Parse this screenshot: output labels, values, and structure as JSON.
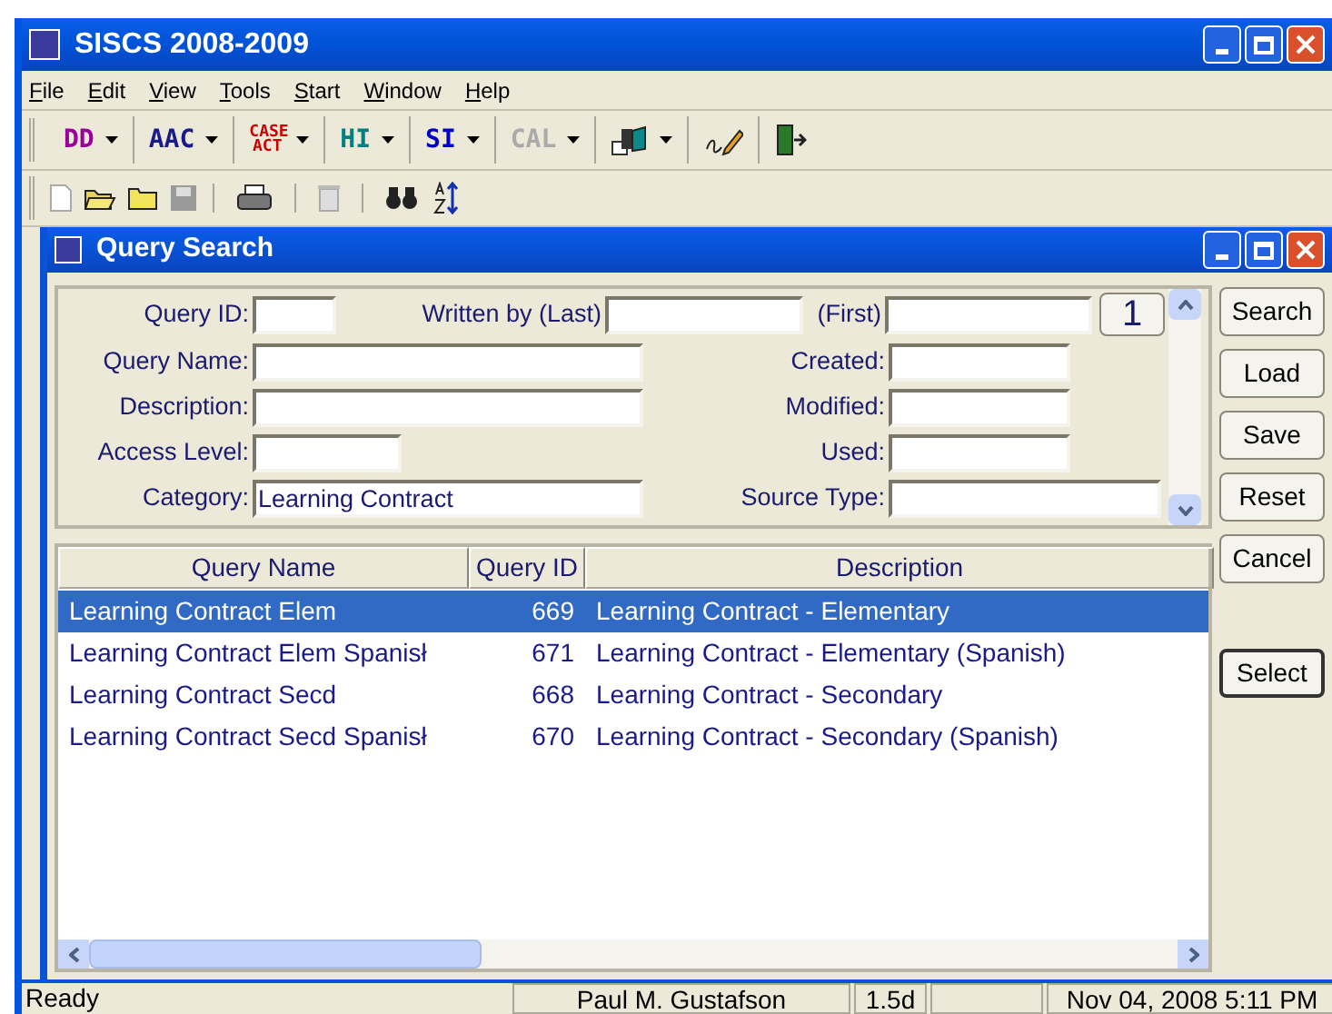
{
  "window": {
    "title": "SISCS 2008-2009"
  },
  "menu": [
    "File",
    "Edit",
    "View",
    "Tools",
    "Start",
    "Window",
    "Help"
  ],
  "toolbar": [
    {
      "kind": "text",
      "label": "DD",
      "color": "#990099",
      "disabled": false
    },
    {
      "kind": "text",
      "label": "AAC",
      "color": "#1a1a8a",
      "disabled": false
    },
    {
      "kind": "stack",
      "label": "CASE ACT",
      "color": "#cc0000",
      "disabled": false
    },
    {
      "kind": "text",
      "label": "HI",
      "color": "#008080",
      "disabled": false
    },
    {
      "kind": "text",
      "label": "SI",
      "color": "#0000cc",
      "disabled": false
    },
    {
      "kind": "text",
      "label": "CAL",
      "disabled": true
    },
    {
      "kind": "folder-menu"
    },
    {
      "kind": "pencil"
    },
    {
      "kind": "door"
    }
  ],
  "query_window": {
    "title": "Query Search",
    "form": {
      "query_id": {
        "label": "Query ID:"
      },
      "written_by_last": {
        "label": "Written by (Last)"
      },
      "written_by_first": {
        "label": "(First)"
      },
      "page_button": "1",
      "left": [
        {
          "label": "Query Name:"
        },
        {
          "label": "Description:"
        },
        {
          "label": "Access Level:"
        },
        {
          "label": "Category:",
          "value": "Learning Contract"
        }
      ],
      "right": [
        {
          "label": "Created:"
        },
        {
          "label": "Modified:"
        },
        {
          "label": "Used:"
        },
        {
          "label": "Source Type:"
        }
      ]
    },
    "buttons": [
      "Search",
      "Load",
      "Save",
      "Reset",
      "Cancel",
      "Select"
    ],
    "table": {
      "columns": [
        "Query Name",
        "Query ID",
        "Description"
      ],
      "rows": [
        {
          "cells": [
            "Learning Contract Elem",
            "669",
            "Learning Contract - Elementary"
          ],
          "selected": true
        },
        {
          "cells": [
            "Learning Contract Elem Spanisł",
            "671",
            "Learning Contract - Elementary (Spanish)"
          ],
          "selected": false
        },
        {
          "cells": [
            "Learning Contract Secd",
            "668",
            "Learning Contract - Secondary"
          ],
          "selected": false
        },
        {
          "cells": [
            "Learning Contract Secd Spanisł",
            "670",
            "Learning Contract - Secondary (Spanish)"
          ],
          "selected": false
        }
      ]
    }
  },
  "status_bar": [
    "Ready",
    "Paul M. Gustafson",
    "1.5d",
    "Nov 04, 2008 5:11 PM"
  ]
}
